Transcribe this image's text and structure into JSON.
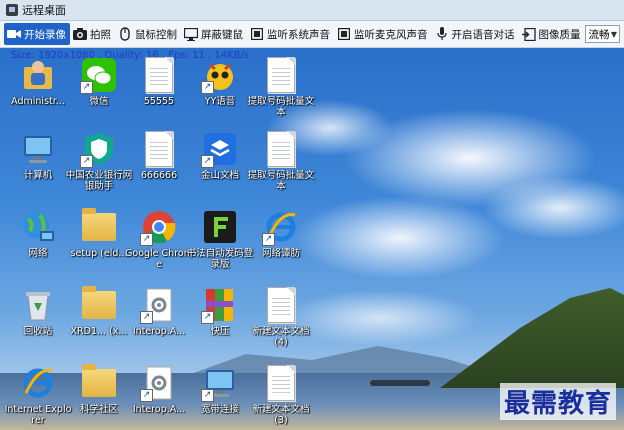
{
  "window": {
    "title": "远程桌面"
  },
  "toolbar": {
    "buttons": [
      {
        "label": "开始录像",
        "icon": "camera-record-icon"
      },
      {
        "label": "拍照",
        "icon": "photo-camera-icon"
      },
      {
        "label": "鼠标控制",
        "icon": "mouse-icon"
      },
      {
        "label": "屏蔽键鼠",
        "icon": "monitor-icon"
      },
      {
        "label": "监听系统声音",
        "icon": "speaker-icon"
      },
      {
        "label": "监听麦克风声音",
        "icon": "speaker-icon"
      },
      {
        "label": "开启语音对话",
        "icon": "microphone-icon"
      },
      {
        "label": "图像质量",
        "icon": "image-quality-icon"
      }
    ],
    "quality_select": {
      "value": "流畅"
    }
  },
  "stats_text": "Size: 1920x1080 , Quality: 16 , Fps: 11 , 14KB/s",
  "desktop_icons": [
    {
      "label": "Administr...",
      "kind": "user-folder"
    },
    {
      "label": "微信",
      "kind": "wechat"
    },
    {
      "label": "55555",
      "kind": "doc"
    },
    {
      "label": "YY语音",
      "kind": "yy"
    },
    {
      "label": "提取号码批量文本",
      "kind": "doc"
    },
    {
      "label": "计算机",
      "kind": "computer"
    },
    {
      "label": "中国农业银行网银助手",
      "kind": "shield"
    },
    {
      "label": "666666",
      "kind": "doc"
    },
    {
      "label": "金山文档",
      "kind": "kdocs"
    },
    {
      "label": "提取号码批量文本",
      "kind": "doc"
    },
    {
      "label": "网络",
      "kind": "network"
    },
    {
      "label": "setup (eld...",
      "kind": "folder"
    },
    {
      "label": "Google Chrome",
      "kind": "chrome"
    },
    {
      "label": "书法自动发码登录版",
      "kind": "green-f"
    },
    {
      "label": "网络谭肪",
      "kind": "ie"
    },
    {
      "label": "回收站",
      "kind": "recycle"
    },
    {
      "label": "XRD1... (x...",
      "kind": "folder"
    },
    {
      "label": "Interop.A...",
      "kind": "gear-doc"
    },
    {
      "label": "快压",
      "kind": "winrar"
    },
    {
      "label": "新建文本文档(4)",
      "kind": "doc"
    },
    {
      "label": "Internet Explorer",
      "kind": "ie"
    },
    {
      "label": "科学社区",
      "kind": "folder"
    },
    {
      "label": "Interop.A...",
      "kind": "gear-doc"
    },
    {
      "label": "宽带连接",
      "kind": "computer"
    },
    {
      "label": "新建文本文档(3)",
      "kind": "doc"
    }
  ],
  "watermark": "最需教育",
  "colors": {
    "toolbar_active": "#1f63c6",
    "stats_text": "#1f3cc7",
    "watermark": "#1a2f9c"
  }
}
